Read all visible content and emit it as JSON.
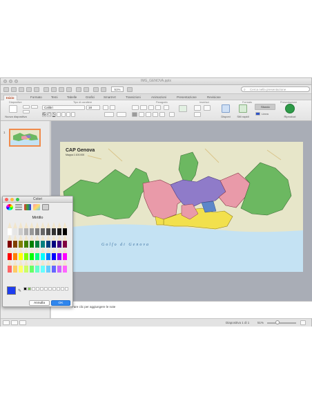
{
  "window": {
    "title": "IMG_GENOVA.pptx"
  },
  "toolbar": {
    "zoom": "51%",
    "search_placeholder": "Cerca nella presentazione"
  },
  "tabs": [
    "Inizio",
    "Formato",
    "Temi",
    "Tabelle",
    "Grafici",
    "SmartArt",
    "Transizioni",
    "Animazioni",
    "Presentazione",
    "Revisione"
  ],
  "active_tab_index": 0,
  "ribbon": {
    "groups": [
      "Diapositive",
      "Tipo di carattere",
      "Paragrafo",
      "Inserisci",
      "Formato",
      "Presentazione"
    ],
    "new_slide_label": "Nuova diapositiva",
    "font_name": "Calibri",
    "font_size": "18",
    "insert_labels": [
      "Disponi",
      "Stili rapidi"
    ],
    "style_labels": [
      "Sfondo",
      "Linea"
    ],
    "play_label": "Riproduci"
  },
  "sidebar": {
    "slide_number": "1"
  },
  "map": {
    "title": "CAP Genova",
    "subtitle": "Mappa 1:100.000",
    "sea_label": "Golfo di Genova",
    "colors": {
      "sea": "#c4e2f3",
      "land": "#e7e6c9",
      "green": "#6cb861",
      "pink": "#e99aa9",
      "purple": "#8f7bc9",
      "yellow": "#f2e04d",
      "blue": "#5d86c9"
    }
  },
  "notes": {
    "text": "Fare clic per aggiungere le note"
  },
  "status": {
    "slide_info": "Diapositiva 1 di 1",
    "zoom": "51%"
  },
  "colors_panel": {
    "title": "Colori",
    "color_name": "Mirtillo",
    "selected_color": "#1e3df0",
    "cancel_label": "Annulla",
    "ok_label": "OK",
    "mode_icons": [
      "color-wheel-icon",
      "sliders-icon",
      "palettes-icon",
      "image-palette-icon",
      "pencils-icon"
    ]
  }
}
